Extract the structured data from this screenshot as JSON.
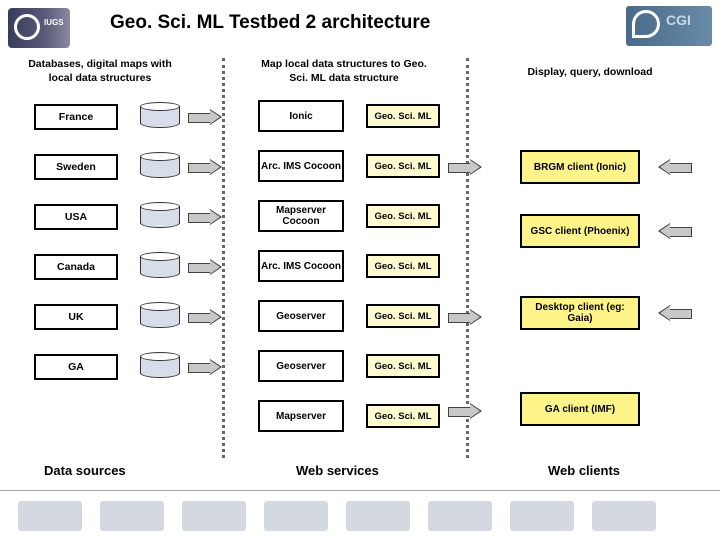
{
  "header": {
    "title": "Geo. Sci. ML Testbed 2 architecture",
    "left_org": "IUGS",
    "right_org": "CGI"
  },
  "columns": {
    "c1": "Databases, digital maps with local data structures",
    "c2": "Map local data structures to Geo. Sci. ML data structure",
    "c3": "Display, query, download"
  },
  "sources": [
    "France",
    "Sweden",
    "USA",
    "Canada",
    "UK",
    "GA"
  ],
  "services": [
    "Ionic",
    "Arc. IMS Cocoon",
    "Mapserver Cocoon",
    "Arc. IMS Cocoon",
    "Geoserver",
    "Geoserver",
    "Mapserver"
  ],
  "output_label": "Geo. Sci. ML",
  "clients": [
    "BRGM client (Ionic)",
    "GSC client (Phoenix)",
    "Desktop client (eg: Gaia)",
    "GA client (IMF)"
  ],
  "bottom": {
    "a": "Data sources",
    "b": "Web services",
    "c": "Web clients"
  }
}
